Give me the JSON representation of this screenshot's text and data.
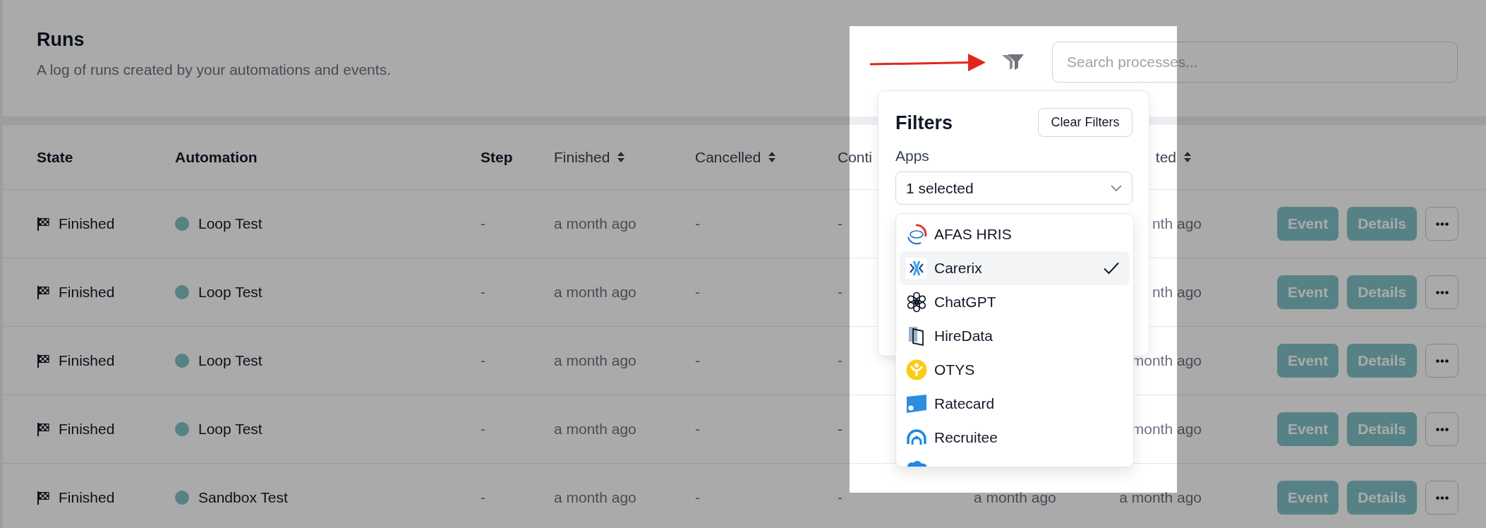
{
  "header": {
    "title": "Runs",
    "subtitle": "A log of runs created by your automations and events."
  },
  "toolbar": {
    "search": {
      "placeholder": "Search processes..."
    }
  },
  "filters": {
    "title": "Filters",
    "clear_button": "Clear Filters",
    "apps_label": "Apps",
    "apps_select": {
      "value": "1 selected"
    },
    "apps_options": [
      {
        "label": "AFAS HRIS",
        "selected": false
      },
      {
        "label": "Carerix",
        "selected": true
      },
      {
        "label": "ChatGPT",
        "selected": false
      },
      {
        "label": "HireData",
        "selected": false
      },
      {
        "label": "OTYS",
        "selected": false
      },
      {
        "label": "Ratecard",
        "selected": false
      },
      {
        "label": "Recruitee",
        "selected": false
      },
      {
        "selected": false
      }
    ]
  },
  "table": {
    "columns": [
      {
        "label": "State",
        "sortable": false
      },
      {
        "label": "Automation",
        "sortable": false
      },
      {
        "label": "Step",
        "sortable": false
      },
      {
        "label": "Finished",
        "sortable": true
      },
      {
        "label": "Cancelled",
        "sortable": true
      },
      {
        "label": "Conti",
        "sortable": false
      },
      {
        "label": "ted",
        "sortable": true
      }
    ],
    "rows": [
      {
        "state": "Finished",
        "automation": "Loop Test",
        "color": "#568286",
        "step": "-",
        "finished": "a month ago",
        "cancelled": "-",
        "column_6": "-",
        "column_8": "nth ago",
        "actions": [
          "Event",
          "Details"
        ]
      },
      {
        "state": "Finished",
        "automation": "Loop Test",
        "color": "#568286",
        "step": "-",
        "finished": "a month ago",
        "cancelled": "-",
        "column_6": "-",
        "column_8": "nth ago",
        "actions": [
          "Event",
          "Details"
        ]
      },
      {
        "state": "Finished",
        "automation": "Loop Test",
        "color": "#568286",
        "step": "-",
        "finished": "a month ago",
        "cancelled": "-",
        "column_6": "-",
        "column_8": "month ago",
        "actions": [
          "Event",
          "Details"
        ]
      },
      {
        "state": "Finished",
        "automation": "Loop Test",
        "color": "#568286",
        "step": "-",
        "finished": "a month ago",
        "cancelled": "-",
        "column_6": "-",
        "column_8": "month ago",
        "actions": [
          "Event",
          "Details"
        ]
      },
      {
        "state": "Finished",
        "automation": "Sandbox Test",
        "color": "#568286",
        "step": "-",
        "finished": "a month ago",
        "cancelled": "-",
        "column_6": "-",
        "column_7": "a month ago",
        "column_8": "a month ago",
        "actions": [
          "Event",
          "Details"
        ]
      }
    ]
  }
}
